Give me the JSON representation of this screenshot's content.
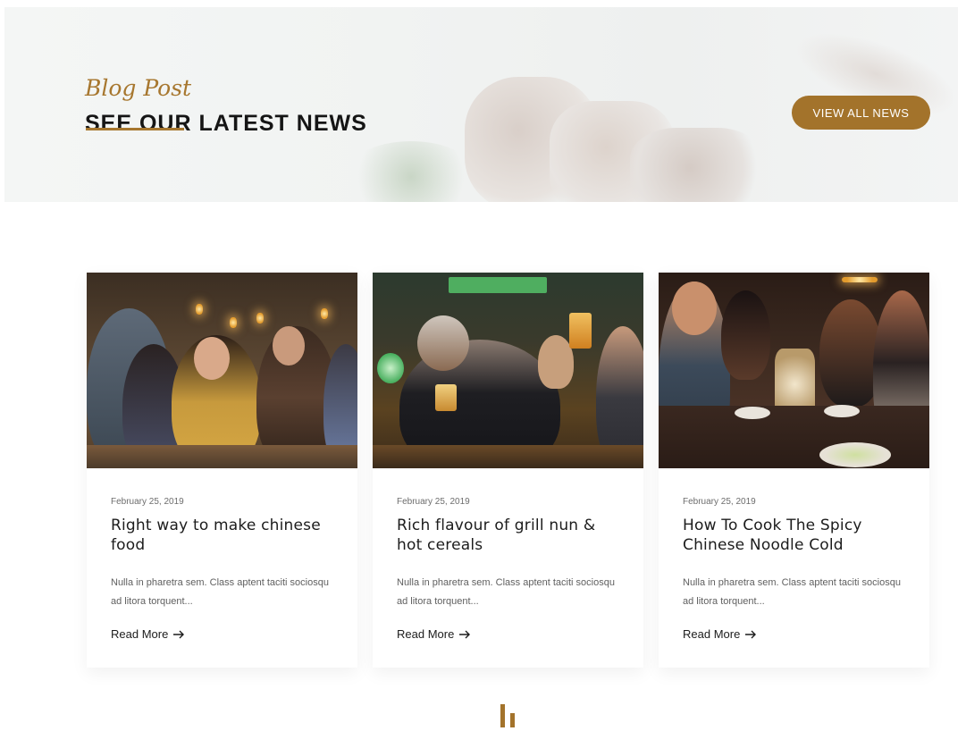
{
  "hero": {
    "subtitle": "Blog Post",
    "title": "SEE OUR LATEST NEWS",
    "button_label": "VIEW ALL NEWS"
  },
  "posts": [
    {
      "date": "February 25, 2019",
      "title": "Right way to make chinese food",
      "excerpt": "Nulla in pharetra sem. Class aptent taciti sociosqu ad litora torquent...",
      "link_label": "Read More"
    },
    {
      "date": "February 25, 2019",
      "title": "Rich flavour of grill nun & hot cereals",
      "excerpt": "Nulla in pharetra sem. Class aptent taciti sociosqu ad litora torquent...",
      "link_label": "Read More"
    },
    {
      "date": "February 25, 2019",
      "title": "How To Cook The Spicy Chinese Noodle Cold",
      "excerpt": "Nulla in pharetra sem. Class aptent taciti sociosqu ad litora torquent...",
      "link_label": "Read More"
    }
  ],
  "colors": {
    "accent": "#a3732b",
    "text": "#1c1c1c",
    "muted": "#5f5f5f"
  },
  "icons": {
    "read_more": "arrow-right-icon",
    "brand": "brand-logo-icon"
  }
}
